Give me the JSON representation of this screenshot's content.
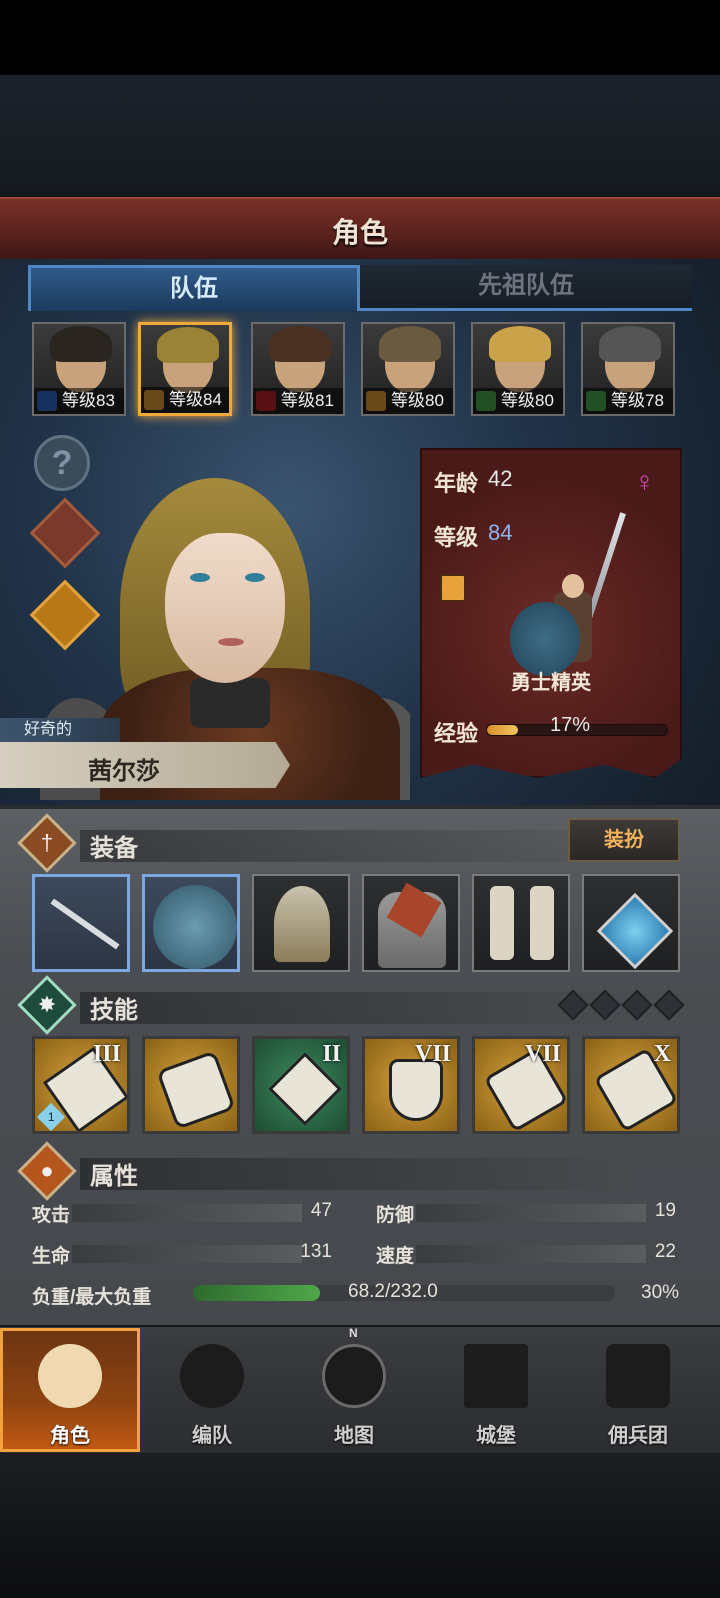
{
  "title": "角色",
  "tabs": [
    {
      "label": "队伍",
      "active": true
    },
    {
      "label": "先祖队伍",
      "active": false
    }
  ],
  "party": [
    {
      "level": "等级83",
      "class_color": "#2f6fd0",
      "hair": "#2b2520",
      "selected": false
    },
    {
      "level": "等级84",
      "class_color": "#e8a23a",
      "hair": "#9a8236",
      "selected": true
    },
    {
      "level": "等级81",
      "class_color": "#c0272d",
      "hair": "#4a3020",
      "selected": false
    },
    {
      "level": "等级80",
      "class_color": "#e8a23a",
      "hair": "#6a5a40",
      "selected": false
    },
    {
      "level": "等级80",
      "class_color": "#4caf50",
      "hair": "#c9a24a",
      "selected": false
    },
    {
      "level": "等级78",
      "class_color": "#4caf50",
      "hair": "#555555",
      "selected": false
    }
  ],
  "side_icons": [
    "question-icon",
    "hooded-figure-icon",
    "potion-icon"
  ],
  "hero": {
    "trait": "好奇的",
    "name": "茜尔莎",
    "age_label": "年龄",
    "age": "42",
    "level_label": "等级",
    "level": "84",
    "gender_icon": "♀",
    "class_name": "勇士精英",
    "exp_label": "经验",
    "exp_pct": "17%",
    "exp_fraction": 0.17
  },
  "equipment": {
    "label": "装备",
    "dress_button": "装扮",
    "slots": [
      "spear-icon",
      "fur-shield-icon",
      "helmet-icon",
      "chainmail-armor-icon",
      "boots-icon",
      "pendant-icon"
    ]
  },
  "skills": {
    "label": "技能",
    "items": [
      {
        "rank": "III",
        "style": "gold",
        "badge": "1"
      },
      {
        "rank": "",
        "style": "gold",
        "badge": ""
      },
      {
        "rank": "II",
        "style": "green",
        "badge": ""
      },
      {
        "rank": "VII",
        "style": "gold",
        "badge": ""
      },
      {
        "rank": "VII",
        "style": "gold",
        "badge": ""
      },
      {
        "rank": "X",
        "style": "gold",
        "badge": ""
      }
    ],
    "gem_slots": 4
  },
  "attributes": {
    "label": "属性",
    "attack_label": "攻击",
    "attack": "47",
    "defense_label": "防御",
    "defense": "19",
    "hp_label": "生命",
    "hp": "131",
    "speed_label": "速度",
    "speed": "22",
    "load_label": "负重/最大负重",
    "load_value": "68.2/232.0",
    "load_pct": "30%",
    "load_fraction": 0.3
  },
  "nav": [
    {
      "label": "角色",
      "active": true
    },
    {
      "label": "编队",
      "active": false
    },
    {
      "label": "地图",
      "active": false
    },
    {
      "label": "城堡",
      "active": false
    },
    {
      "label": "佣兵团",
      "active": false
    }
  ],
  "compass_north": "N",
  "colors": {
    "accent_orange": "#f2a93b",
    "team_tab_blue": "#4f86c4",
    "gender_female": "#d048b8"
  }
}
